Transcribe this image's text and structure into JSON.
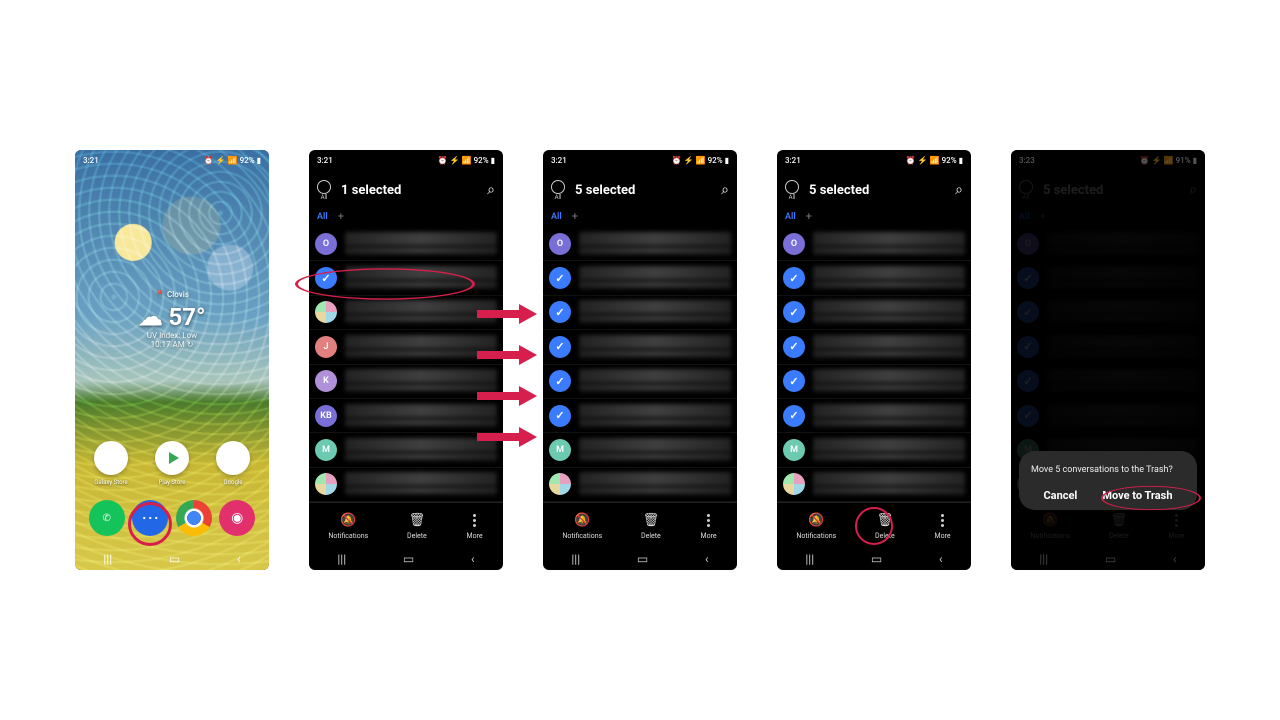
{
  "status": {
    "time1": "3:21",
    "time2": "3:21",
    "time3": "3:21",
    "time4": "3:21",
    "time5": "3:23",
    "battery_high": "92%",
    "battery_low": "91%",
    "indicators": "⏰ ⚡ 📶"
  },
  "home": {
    "location": "📍 Clovis",
    "temperature": "57°",
    "uv": "UV Index: Low",
    "time": "10:17 AM ↻",
    "apps_row": [
      {
        "name": "galaxy-store",
        "label": "Galaxy Store"
      },
      {
        "name": "play-store",
        "label": "Play Store"
      },
      {
        "name": "google",
        "label": "Google"
      }
    ],
    "dock": [
      {
        "name": "phone-app",
        "glyph": "✆"
      },
      {
        "name": "messages-app",
        "glyph": "⋯"
      },
      {
        "name": "chrome-app",
        "glyph": ""
      },
      {
        "name": "instagram-app",
        "glyph": "◉"
      }
    ]
  },
  "selection": {
    "all_label": "All",
    "title_1": "1 selected",
    "title_5": "5 selected",
    "tab_all": "All",
    "contacts": [
      {
        "initial": "O",
        "color": "#7a6fd6"
      },
      {
        "initial": "",
        "checked": true
      },
      {
        "initial": "",
        "color": "#e8a0c0",
        "split": true
      },
      {
        "initial": "J",
        "color": "#e28080"
      },
      {
        "initial": "K",
        "color": "#b090d8"
      },
      {
        "initial": "KB",
        "color": "#7a6fd6"
      },
      {
        "initial": "M",
        "color": "#6ccab0"
      },
      {
        "initial": "",
        "color": "#e8a0c0",
        "split": true
      }
    ],
    "contacts_5": [
      {
        "initial": "O",
        "color": "#7a6fd6"
      },
      {
        "checked": true
      },
      {
        "checked": true
      },
      {
        "checked": true
      },
      {
        "checked": true
      },
      {
        "checked": true
      },
      {
        "initial": "M",
        "color": "#6ccab0"
      },
      {
        "initial": "",
        "color": "#e8a0c0",
        "split": true
      }
    ]
  },
  "actions": {
    "notifications": "Notifications",
    "delete": "Delete",
    "more": "More"
  },
  "dialog": {
    "question": "Move 5 conversations to the Trash?",
    "cancel": "Cancel",
    "confirm": "Move to Trash"
  },
  "icons": {
    "search": "search-icon",
    "bell_off": "bell-off-icon",
    "trash": "trash-icon",
    "more": "more-icon"
  },
  "colors": {
    "accent": "#3a7bff",
    "annotation": "#d61f4c"
  }
}
